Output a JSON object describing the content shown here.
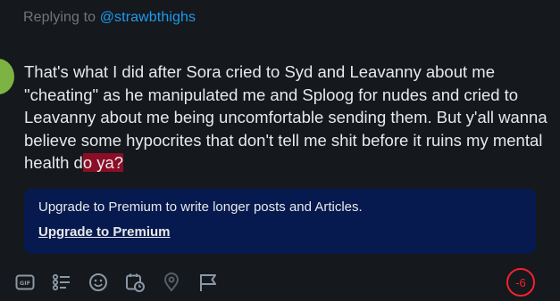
{
  "reply": {
    "prefix": "Replying to ",
    "handle": "@strawbthighs"
  },
  "post": {
    "text_main": "That's what I did after Sora cried to Syd and Leavanny about me \"cheating\" as he manipulated me and Sploog for nudes and cried to Leavanny about me being uncomfortable sending them. But y'all wanna believe some hypocrites that don't tell me shit before it ruins my mental health d",
    "text_overflow": "o ya?"
  },
  "premium": {
    "message": "Upgrade to Premium to write longer posts and Articles.",
    "link_label": "Upgrade to Premium"
  },
  "toolbar": {
    "icons": [
      "gif-icon",
      "poll-icon",
      "emoji-icon",
      "schedule-icon",
      "location-icon",
      "flag-icon"
    ]
  },
  "counter": {
    "remaining": "-6"
  },
  "colors": {
    "background": "#15181c",
    "accent": "#1d9bf0",
    "overflow_highlight": "#8b0e26",
    "premium_box": "#061a4f",
    "counter_red": "#f4212e"
  }
}
